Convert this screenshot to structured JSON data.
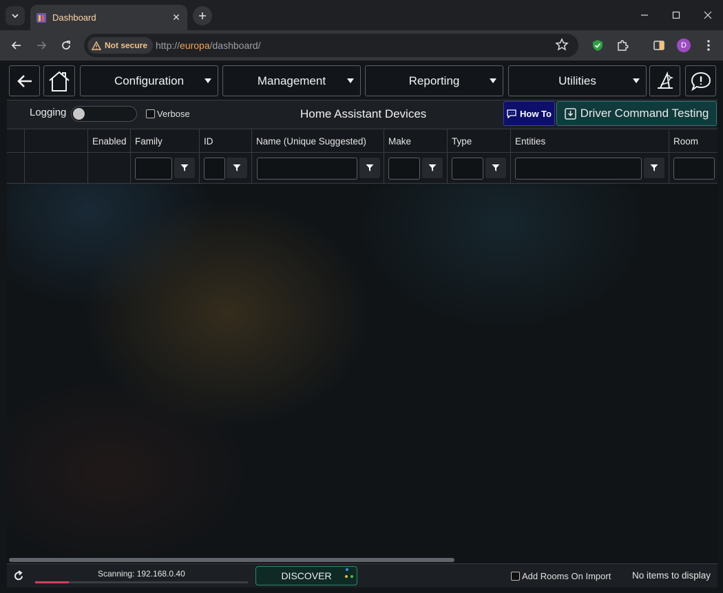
{
  "browser": {
    "tab_title": "Dashboard",
    "security_chip": "Not secure",
    "url_scheme": "http://",
    "url_host": "europa",
    "url_path": "/dashboard/",
    "profile_initial": "D"
  },
  "nav": {
    "menus": [
      {
        "label": "Configuration"
      },
      {
        "label": "Management"
      },
      {
        "label": "Reporting"
      },
      {
        "label": "Utilities"
      }
    ]
  },
  "subheader": {
    "logging_label": "Logging",
    "logging_on": false,
    "verbose_label": "Verbose",
    "verbose_checked": false,
    "title": "Home Assistant Devices",
    "howto_label": "How To",
    "driver_button_label": "Driver Command Testing"
  },
  "grid": {
    "columns": [
      "",
      "",
      "Enabled",
      "Family",
      "ID",
      "Name (Unique Suggested)",
      "Make",
      "Type",
      "Entities",
      "Room"
    ],
    "rows": []
  },
  "footer": {
    "scanning_text": "Scanning: 192.168.0.40",
    "scan_progress": 0.16,
    "discover_label": "DISCOVER",
    "add_rooms_label": "Add Rooms On Import",
    "add_rooms_checked": false,
    "status_text": "No items to display"
  },
  "colors": {
    "accent_orange": "#f0a45a",
    "howto_bg": "#0d0f6b",
    "driver_btn_bg": "#103a3c",
    "discover_border": "#2b8a6a",
    "progress_fill": "#d0405a"
  }
}
